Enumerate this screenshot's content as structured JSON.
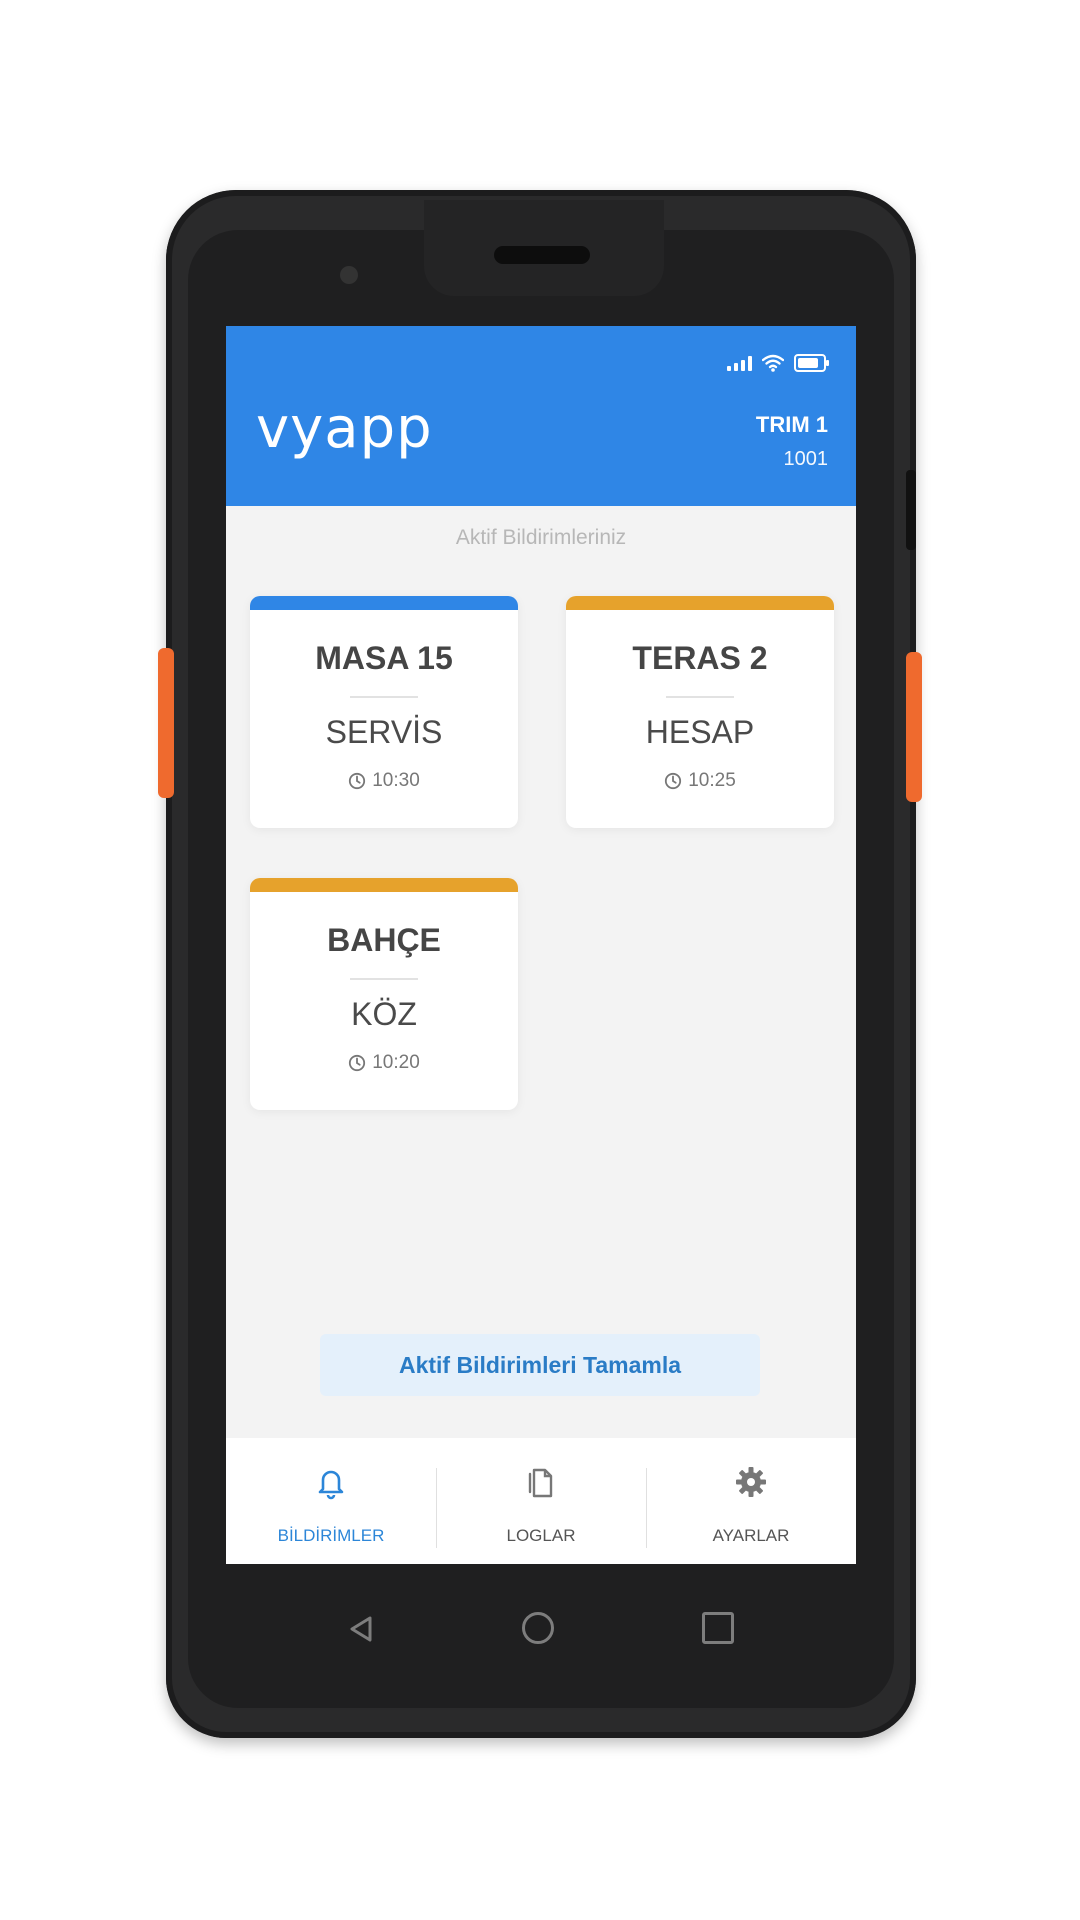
{
  "app": {
    "brand": "vyapp",
    "device_name": "TRIM 1",
    "device_id": "1001"
  },
  "status_bar": {
    "icons": [
      "signal-icon",
      "wifi-icon",
      "battery-icon"
    ]
  },
  "main": {
    "section_title": "Aktif Bildirimleriniz",
    "cards": [
      {
        "title": "MASA 15",
        "type": "SERVİS",
        "time": "10:30",
        "accent": "#2f86e6"
      },
      {
        "title": "TERAS 2",
        "type": "HESAP",
        "time": "10:25",
        "accent": "#e6a22c"
      },
      {
        "title": "BAHÇE",
        "type": "KÖZ",
        "time": "10:20",
        "accent": "#e6a22c"
      }
    ],
    "complete_button": "Aktif Bildirimleri Tamamla"
  },
  "bottom_nav": {
    "items": [
      {
        "label": "BİLDİRİMLER",
        "icon": "bell-icon",
        "active": true
      },
      {
        "label": "LOGLAR",
        "icon": "document-icon",
        "active": false
      },
      {
        "label": "AYARLAR",
        "icon": "gear-icon",
        "active": false
      }
    ]
  },
  "colors": {
    "primary": "#2f86e6",
    "warning": "#e6a22c",
    "active_nav": "#2c86d8"
  }
}
